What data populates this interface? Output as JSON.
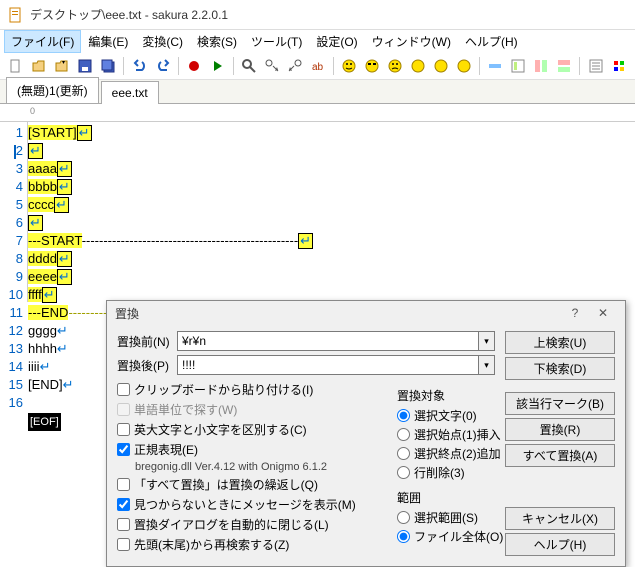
{
  "window": {
    "title": "デスクトップ\\eee.txt - sakura 2.2.0.1"
  },
  "menu": {
    "file": "ファイル(F)",
    "edit": "編集(E)",
    "convert": "変換(C)",
    "search": "検索(S)",
    "tools": "ツール(T)",
    "settings": "設定(O)",
    "window": "ウィンドウ(W)",
    "help": "ヘルプ(H)"
  },
  "tabs": {
    "t1": "(無題)1(更新)",
    "t2": "eee.txt"
  },
  "ruler": {
    "zero": "0"
  },
  "lines": {
    "n1": "1",
    "n2": "2",
    "n3": "3",
    "n4": "4",
    "n5": "5",
    "n6": "6",
    "n7": "7",
    "n8": "8",
    "n9": "9",
    "n10": "10",
    "n11": "11",
    "n12": "12",
    "n13": "13",
    "n14": "14",
    "n15": "15",
    "n16": "16",
    "l1": "[START]",
    "l3": "aaaa",
    "l4": "bbbb",
    "l5": "cccc",
    "l7a": "---START",
    "l7b": "--------------------------------------------------",
    "l8": "dddd",
    "l9": "eeee",
    "l10": "ffff",
    "l11a": "---END",
    "l11b": "----------------------------------------------------↓",
    "l12": "gggg",
    "l13": "hhhh",
    "l14": "iiii",
    "l15": "[END]",
    "eof": "[EOF]",
    "ret": "↵"
  },
  "dialog": {
    "title": "置換",
    "before_label": "置換前(N)",
    "before_value": "¥r¥n",
    "after_label": "置換後(P)",
    "after_value": "!!!!",
    "btn_up": "上検索(U)",
    "btn_down": "下検索(D)",
    "btn_mark": "該当行マーク(B)",
    "btn_replace": "置換(R)",
    "btn_replace_all": "すべて置換(A)",
    "btn_cancel": "キャンセル(X)",
    "btn_help": "ヘルプ(H)",
    "chk_clipboard": "クリップボードから貼り付ける(I)",
    "chk_word": "単語単位で探す(W)",
    "chk_case": "英大文字と小文字を区別する(C)",
    "chk_regex": "正規表現(E)",
    "regex_info": "bregonig.dll Ver.4.12 with Onigmo 6.1.2",
    "chk_loop": "「すべて置換」は置換の繰返し(Q)",
    "chk_msg": "見つからないときにメッセージを表示(M)",
    "chk_autoclose": "置換ダイアログを自動的に閉じる(L)",
    "chk_head": "先頭(末尾)から再検索する(Z)",
    "grp_target": "置換対象",
    "rt_selchar": "選択文字(0)",
    "rt_selstart": "選択始点(1)挿入",
    "rt_selend": "選択終点(2)追加",
    "rt_linedel": "行削除(3)",
    "grp_range": "範囲",
    "rr_sel": "選択範囲(S)",
    "rr_all": "ファイル全体(O)"
  }
}
